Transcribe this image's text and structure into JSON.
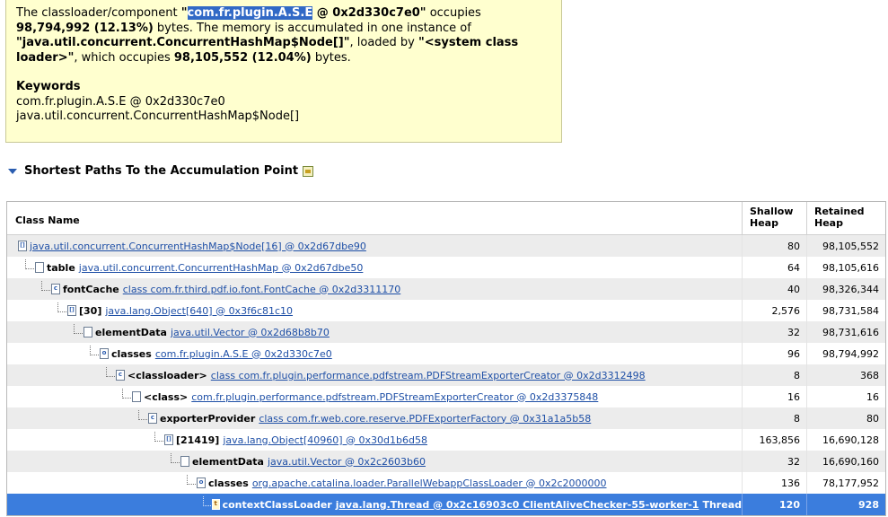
{
  "description": {
    "part1": "The classloader/component ",
    "q1": "\"",
    "highlight": "com.fr.plugin.A.S.E",
    "part2": " @ 0x2d330c7e0\"",
    "part3": " occupies ",
    "bytes1": "98,794,992 (12.13%)",
    "part4": " bytes. The memory is accumulated in one instance of ",
    "instance": "\"java.util.concurrent.ConcurrentHashMap$Node[]\"",
    "part5": ", loaded by ",
    "loader": "\"<system class loader>\"",
    "part6": ", which occupies ",
    "bytes2": "98,105,552 (12.04%)",
    "part7": " bytes."
  },
  "keywords": {
    "title": "Keywords",
    "items": [
      "com.fr.plugin.A.S.E @ 0x2d330c7e0",
      "java.util.concurrent.ConcurrentHashMap$Node[]"
    ]
  },
  "section": {
    "title": "Shortest Paths To the Accumulation Point"
  },
  "table": {
    "headers": {
      "name": "Class Name",
      "shallow": "Shallow Heap",
      "retained": "Retained Heap"
    },
    "rows": [
      {
        "field": "",
        "link": "java.util.concurrent.ConcurrentHashMap$Node[16] @ 0x2d67dbe90",
        "extra": "",
        "shallow": "80",
        "retained": "98,105,552"
      },
      {
        "field": "table",
        "link": "java.util.concurrent.ConcurrentHashMap @ 0x2d67dbe50",
        "extra": "",
        "shallow": "64",
        "retained": "98,105,616"
      },
      {
        "field": "fontCache",
        "link": "class com.fr.third.pdf.io.font.FontCache @ 0x2d3311170",
        "extra": "",
        "shallow": "40",
        "retained": "98,326,344"
      },
      {
        "field": "[30]",
        "link": "java.lang.Object[640] @ 0x3f6c81c10",
        "extra": "",
        "shallow": "2,576",
        "retained": "98,731,584"
      },
      {
        "field": "elementData",
        "link": "java.util.Vector @ 0x2d68b8b70",
        "extra": "",
        "shallow": "32",
        "retained": "98,731,616"
      },
      {
        "field": "classes",
        "link": "com.fr.plugin.A.S.E @ 0x2d330c7e0",
        "extra": "",
        "shallow": "96",
        "retained": "98,794,992"
      },
      {
        "field": "<classloader>",
        "link": "class com.fr.plugin.performance.pdfstream.PDFStreamExporterCreator @ 0x2d3312498",
        "extra": "",
        "shallow": "8",
        "retained": "368"
      },
      {
        "field": "<class>",
        "link": "com.fr.plugin.performance.pdfstream.PDFStreamExporterCreator @ 0x2d3375848",
        "extra": "",
        "shallow": "16",
        "retained": "16"
      },
      {
        "field": "exporterProvider",
        "link": "class com.fr.web.core.reserve.PDFExporterFactory @ 0x31a1a5b58",
        "extra": "",
        "shallow": "8",
        "retained": "80"
      },
      {
        "field": "[21419]",
        "link": "java.lang.Object[40960] @ 0x30d1b6d58",
        "extra": "",
        "shallow": "163,856",
        "retained": "16,690,128"
      },
      {
        "field": "elementData",
        "link": "java.util.Vector @ 0x2c2603b60",
        "extra": "",
        "shallow": "32",
        "retained": "16,690,160"
      },
      {
        "field": "classes",
        "link": "org.apache.catalina.loader.ParallelWebappClassLoader @ 0x2c2000000",
        "extra": "",
        "shallow": "136",
        "retained": "78,177,952"
      },
      {
        "field": "contextClassLoader",
        "link": "java.lang.Thread @ 0x2c16903c0 ClientAliveChecker-55-worker-1",
        "extra": "Thread",
        "shallow": "120",
        "retained": "928"
      }
    ]
  }
}
